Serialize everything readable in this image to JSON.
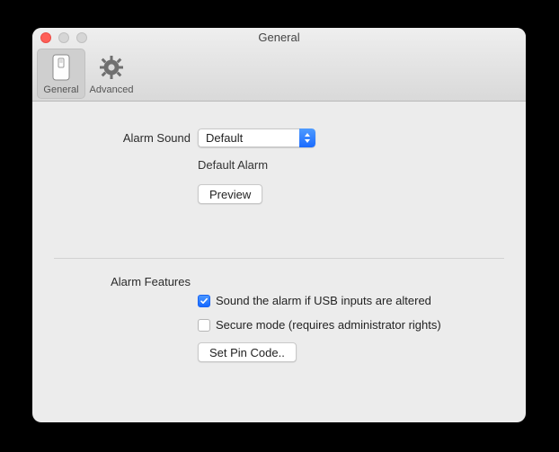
{
  "window": {
    "title": "General"
  },
  "toolbar": {
    "general_label": "General",
    "advanced_label": "Advanced"
  },
  "alarmSound": {
    "label": "Alarm Sound",
    "selected": "Default",
    "sub": "Default Alarm",
    "preview_label": "Preview"
  },
  "features": {
    "label": "Alarm Features",
    "usb_check_label": "Sound the alarm if USB inputs are altered",
    "usb_checked": true,
    "secure_check_label": "Secure mode (requires administrator rights)",
    "secure_checked": false,
    "pin_button_label": "Set Pin Code.."
  }
}
